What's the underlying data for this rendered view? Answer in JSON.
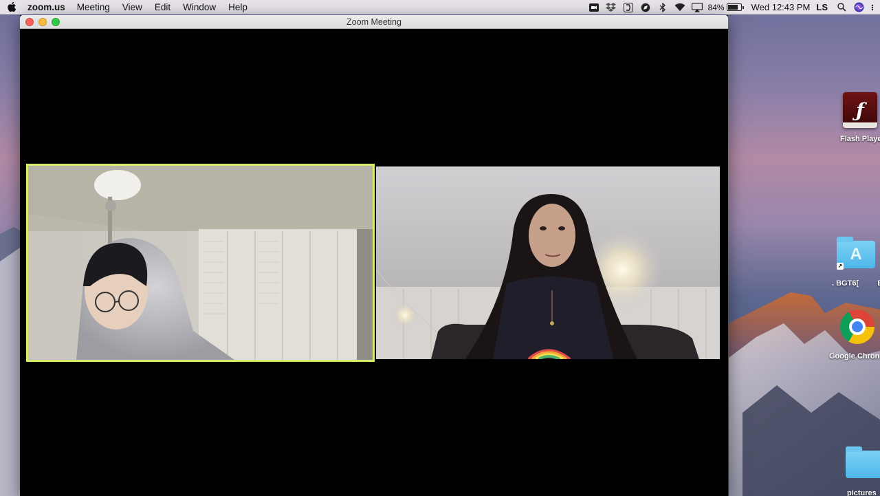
{
  "menubar": {
    "apple_icon": "apple-icon",
    "app_name": "zoom.us",
    "items": [
      "Meeting",
      "View",
      "Edit",
      "Window",
      "Help"
    ],
    "status_icons": [
      "zoom-camera-icon",
      "dropbox-icon",
      "readability-icon",
      "compass-icon",
      "bluetooth-icon",
      "wifi-icon",
      "airplay-icon"
    ],
    "battery_percent": "84%",
    "battery_level": 0.84,
    "clock": "Wed 12:43 PM",
    "user_initials": "LS",
    "search_icon": "spotlight-search-icon",
    "siri_icon": "siri-icon"
  },
  "window": {
    "title": "Zoom Meeting",
    "active_speaker_border_color": "#d8ee6b",
    "participants": [
      {
        "role": "video-tile",
        "active_speaker": true
      },
      {
        "role": "video-tile",
        "active_speaker": false
      }
    ]
  },
  "desktop": {
    "icons": [
      {
        "label": "Flash Playe",
        "icon": "flash-player-icon"
      },
      {
        "label": ". BGT6[",
        "icon": "app-store-folder-icon"
      },
      {
        "label": "B",
        "icon": "folder-icon"
      },
      {
        "label": "Google Chron",
        "icon": "chrome-icon"
      },
      {
        "label": "pictures",
        "icon": "folder-icon"
      }
    ]
  }
}
